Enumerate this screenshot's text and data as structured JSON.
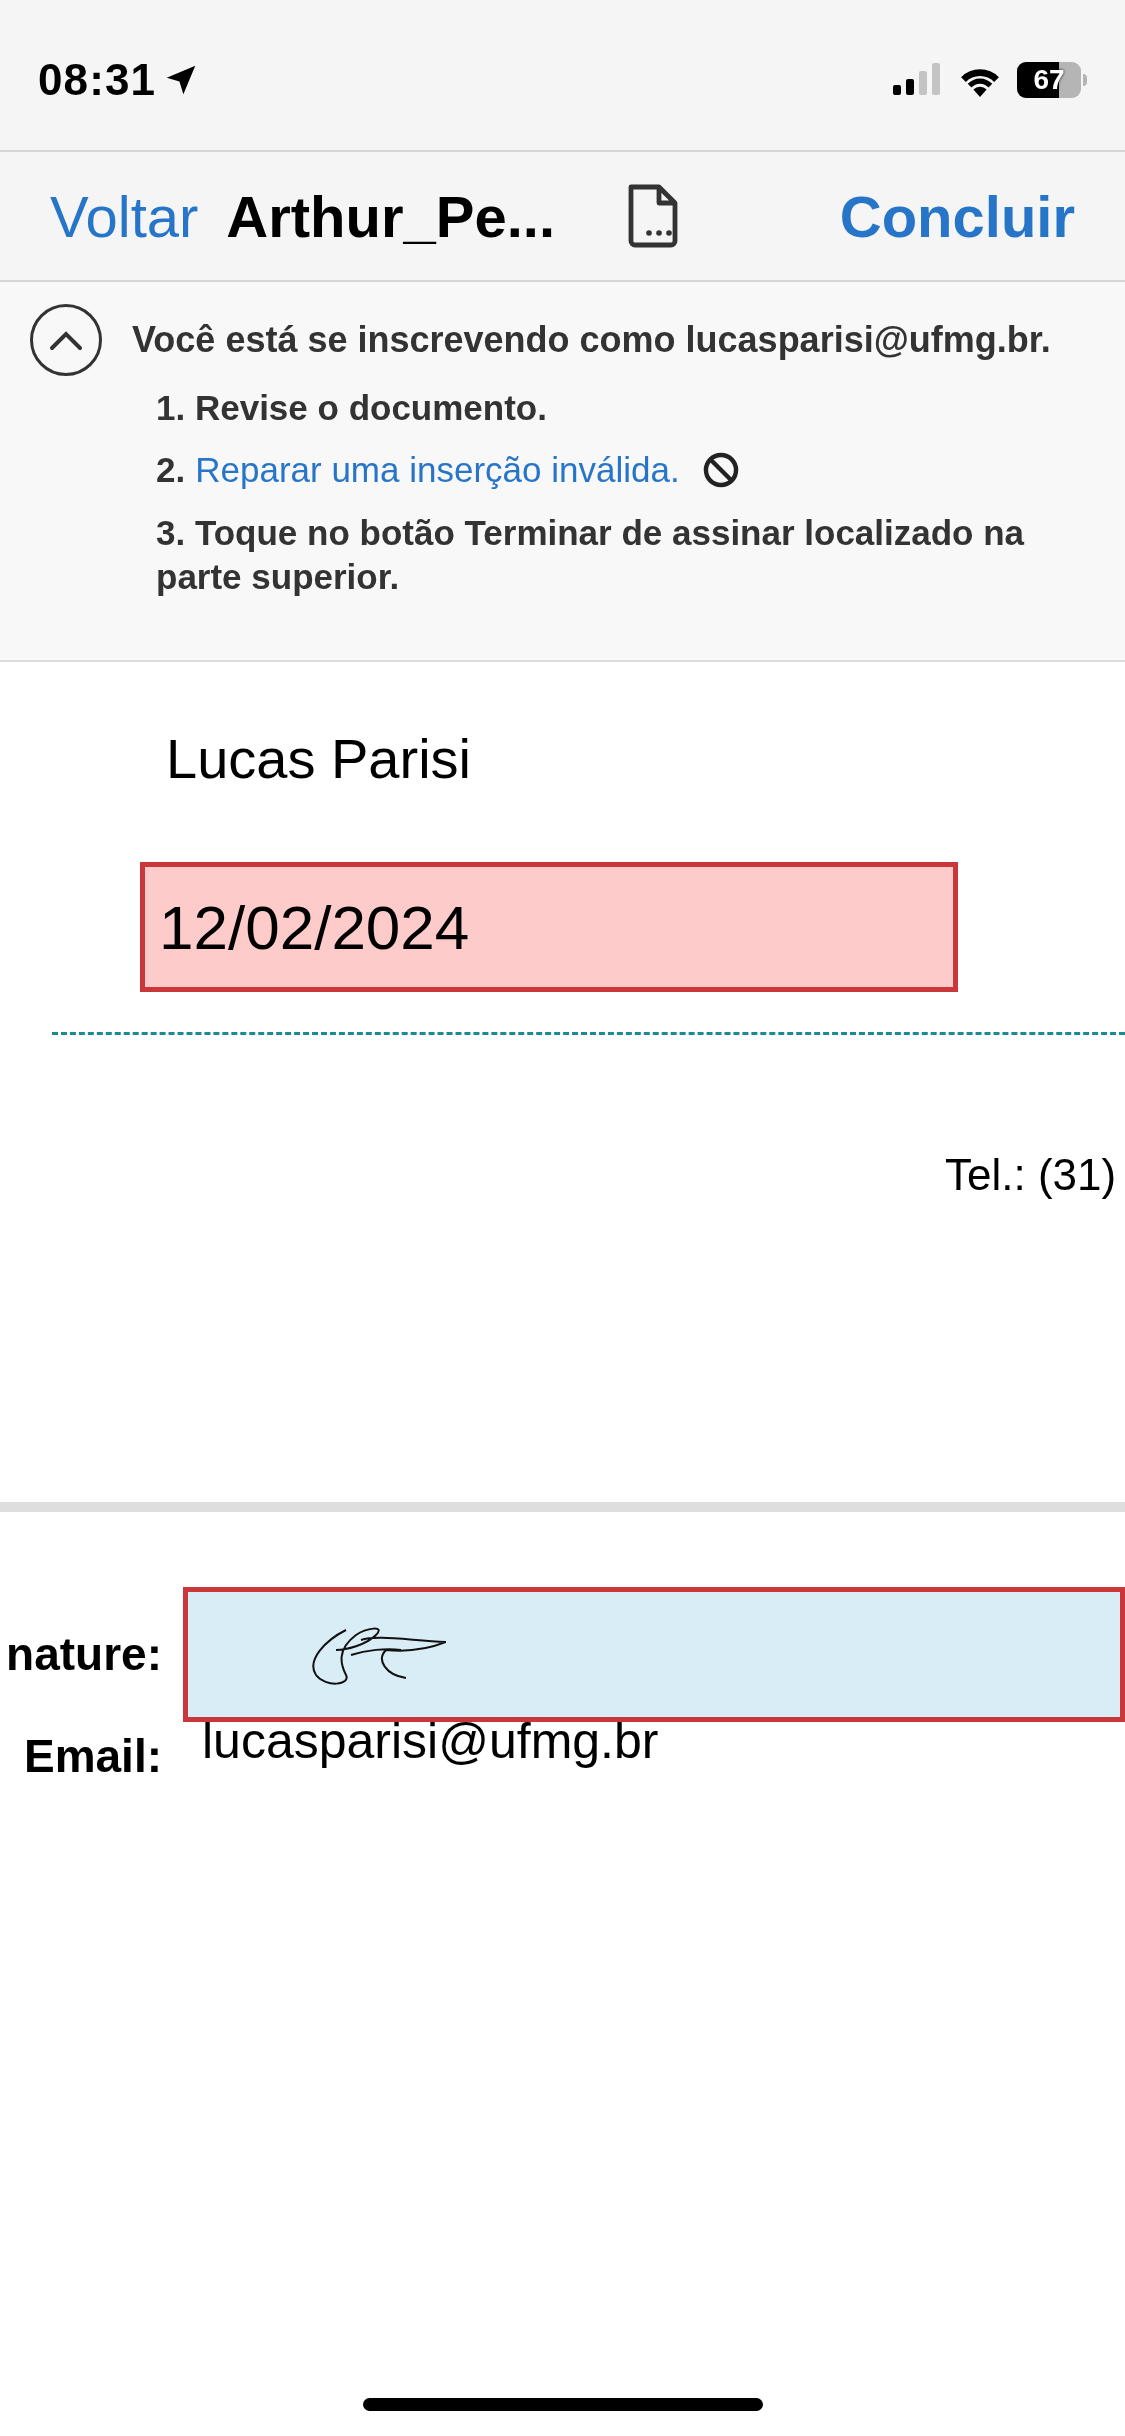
{
  "status_bar": {
    "time": "08:31",
    "battery": "67"
  },
  "nav": {
    "back": "Voltar",
    "title": "Arthur_Pe...",
    "done": "Concluir"
  },
  "instructions": {
    "expanded": true,
    "heading": "Você está se inscrevendo como lucasparisi@ufmg.br.",
    "steps": [
      {
        "number": "1.",
        "text": "Revise o documento.",
        "kind": "text"
      },
      {
        "number": "2.",
        "text": "Reparar uma inserção inválida.",
        "kind": "link"
      },
      {
        "number": "3.",
        "text": "Toque no botão Terminar de assinar localizado na parte superior.",
        "kind": "text"
      }
    ]
  },
  "page_1": {
    "name": "Lucas Parisi",
    "date_field": {
      "value": "12/02/2024",
      "invalid": true
    },
    "phone": "Tel.: (31)"
  },
  "page_2": {
    "fields": [
      {
        "label": "nature:",
        "kind": "signature",
        "invalid": true
      },
      {
        "label": "Email:",
        "kind": "text",
        "value": "lucasparisi@ufmg.br"
      }
    ]
  }
}
